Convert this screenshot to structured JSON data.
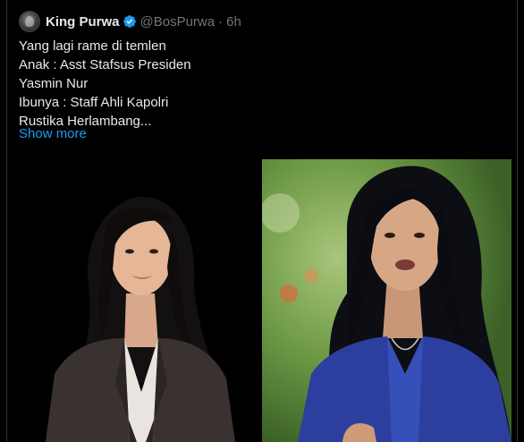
{
  "tweet": {
    "display_name": "King Purwa",
    "handle": "@BosPurwa",
    "separator": "·",
    "time": "6h",
    "lines": [
      "Yang lagi rame di temlen",
      "Anak : Asst Stafsus Presiden",
      "Yasmin Nur",
      "Ibunya : Staff Ahli Kapolri",
      "Rustika Herlambang..."
    ],
    "show_more": "Show more"
  },
  "icons": {
    "verified": "verified-badge-icon",
    "avatar": "profile-avatar"
  },
  "colors": {
    "background": "#000000",
    "text": "#e7e9ea",
    "secondary": "#71767b",
    "link": "#1d9bf0",
    "verified": "#1d9bf0"
  }
}
